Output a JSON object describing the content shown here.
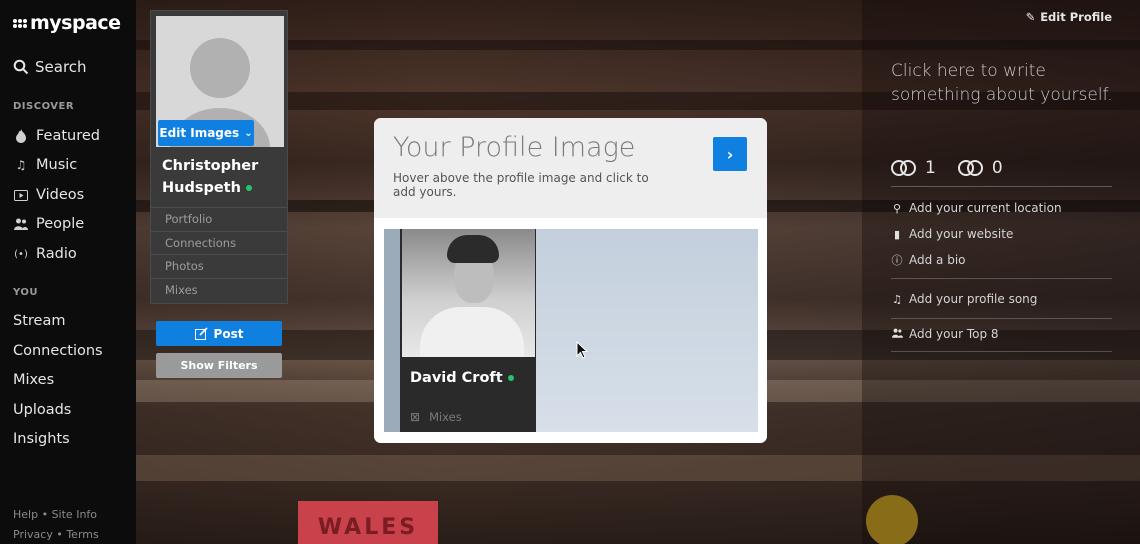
{
  "nav": {
    "logo": "myspace",
    "search": "Search",
    "discover_label": "DISCOVER",
    "discover_items": [
      "Featured",
      "Music",
      "Videos",
      "People",
      "Radio"
    ],
    "you_label": "YOU",
    "you_items": [
      "Stream",
      "Connections",
      "Mixes",
      "Uploads",
      "Insights"
    ],
    "footer_line1": [
      "Help",
      "Site Info"
    ],
    "footer_line2": [
      "Privacy",
      "Terms"
    ]
  },
  "profile": {
    "edit_images": "Edit Images",
    "first_name": "Christopher",
    "last_name": "Hudspeth",
    "links": [
      "Portfolio",
      "Connections",
      "Photos",
      "Mixes"
    ],
    "post_button": "Post",
    "show_filters": "Show Filters"
  },
  "right_panel": {
    "edit_profile": "Edit Profile",
    "about_placeholder": "Click here to write something about yourself.",
    "connections_in": "1",
    "connections_out": "0",
    "details": [
      {
        "icon": "location-pin-icon",
        "label": "Add your current location"
      },
      {
        "icon": "bookmark-icon",
        "label": "Add your website"
      },
      {
        "icon": "info-icon",
        "label": "Add a bio"
      },
      {
        "icon": "music-note-icon",
        "label": "Add your profile song"
      },
      {
        "icon": "people-icon",
        "label": "Add your Top 8"
      }
    ]
  },
  "modal": {
    "title": "Your Profile Image",
    "description": "Hover above the profile image and click to add yours.",
    "demo_name": "David Croft",
    "demo_link": "Mixes"
  },
  "background": {
    "sign_text": "WALES"
  },
  "colors": {
    "accent": "#0f80e0",
    "online": "#26c46a"
  }
}
